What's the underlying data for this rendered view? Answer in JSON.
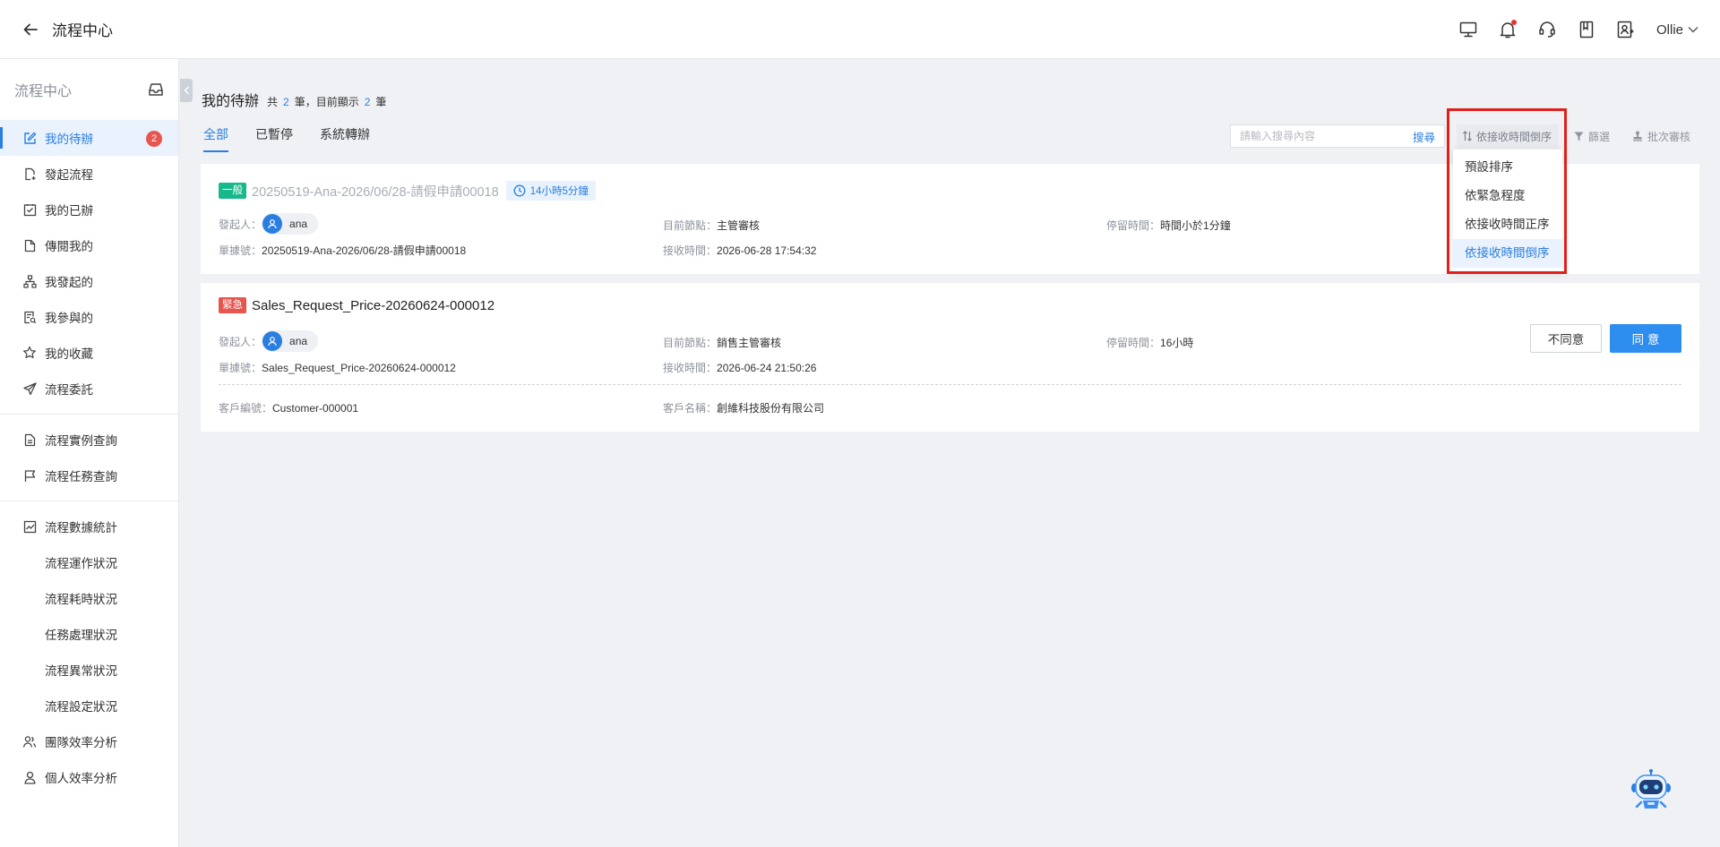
{
  "header": {
    "title": "流程中心",
    "user": "Ollie"
  },
  "sidebar": {
    "title": "流程中心",
    "badge": "2",
    "group1": [
      {
        "label": "我的待辦",
        "icon": "edit-icon"
      },
      {
        "label": "發起流程",
        "icon": "file-add-icon"
      },
      {
        "label": "我的已辦",
        "icon": "check-square-icon"
      },
      {
        "label": "傳閱我的",
        "icon": "file-icon"
      },
      {
        "label": "我發起的",
        "icon": "org-chart-icon"
      },
      {
        "label": "我參與的",
        "icon": "file-search-icon"
      },
      {
        "label": "我的收藏",
        "icon": "star-icon"
      },
      {
        "label": "流程委託",
        "icon": "send-icon"
      }
    ],
    "group2": [
      {
        "label": "流程實例查詢",
        "icon": "document-icon"
      },
      {
        "label": "流程任務查詢",
        "icon": "flag-icon"
      }
    ],
    "group3": {
      "label": "流程數據統計",
      "children": [
        "流程運作狀況",
        "流程耗時狀況",
        "任務處理狀況",
        "流程異常狀況",
        "流程設定狀況"
      ]
    },
    "group4": [
      {
        "label": "團隊效率分析",
        "icon": "team-icon"
      },
      {
        "label": "個人效率分析",
        "icon": "person-icon"
      }
    ]
  },
  "main": {
    "heading": "我的待辦",
    "count_prefix": "共",
    "count_total": "2",
    "count_mid": "筆，目前顯示",
    "count_shown": "2",
    "count_suffix": "筆",
    "tabs": [
      "全部",
      "已暫停",
      "系統轉辦"
    ],
    "search": {
      "placeholder": "請輸入搜尋內容",
      "button": "搜尋"
    },
    "sort_label": "依接收時間倒序",
    "filter_label": "篩選",
    "batch_label": "批次審核",
    "sort_options": [
      "預設排序",
      "依緊急程度",
      "依接收時間正序",
      "依接收時間倒序"
    ]
  },
  "cards": [
    {
      "tag": "一般",
      "title": "20250519-Ana-2026/06/28-請假申請00018",
      "timer": "14小時5分鐘",
      "initiator_label": "發起人：",
      "initiator": "ana",
      "node_label": "目前節點：",
      "node": "主管審核",
      "stay_label": "停留時間：",
      "stay": "時間小於1分鐘",
      "doc_label": "單據號：",
      "doc": "20250519-Ana-2026/06/28-請假申請00018",
      "recv_label": "接收時間：",
      "recv": "2026-06-28 17:54:32"
    },
    {
      "tag": "緊急",
      "title": "Sales_Request_Price-20260624-000012",
      "initiator_label": "發起人：",
      "initiator": "ana",
      "node_label": "目前節點：",
      "node": "銷售主管審核",
      "stay_label": "停留時間：",
      "stay": "16小時",
      "doc_label": "單據號：",
      "doc": "Sales_Request_Price-20260624-000012",
      "recv_label": "接收時間：",
      "recv": "2026-06-24 21:50:26",
      "cust_no_label": "客戶編號：",
      "cust_no": "Customer-000001",
      "cust_name_label": "客戶名稱：",
      "cust_name": "創維科技股份有限公司",
      "reject_label": "不同意",
      "approve_label": "同 意"
    }
  ],
  "colors": {
    "accent": "#2a7ee0",
    "urgent": "#e8554f",
    "normal": "#19b88a",
    "highlight": "#e2201a"
  }
}
